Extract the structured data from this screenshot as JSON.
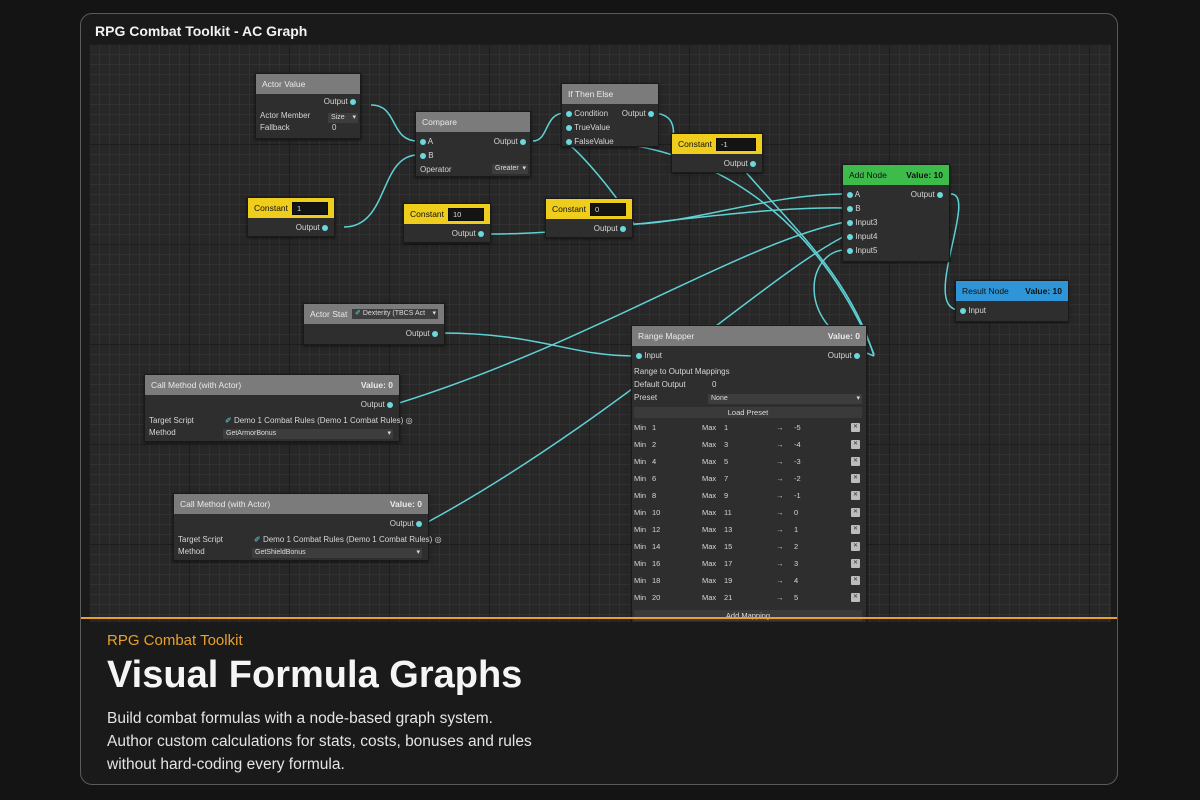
{
  "window": {
    "title": "RPG Combat Toolkit - AC Graph"
  },
  "nodes": {
    "actor_value": {
      "title": "Actor Value",
      "output": "Output",
      "member_label": "Actor Member",
      "member_value": "Size",
      "fallback_label": "Fallback",
      "fallback_value": "0"
    },
    "compare": {
      "title": "Compare",
      "in_a": "A",
      "in_b": "B",
      "output": "Output",
      "operator_label": "Operator",
      "operator_value": "Greater"
    },
    "if_then_else": {
      "title": "If Then Else",
      "condition": "Condition",
      "true_value": "TrueValue",
      "false_value": "FalseValue",
      "output": "Output"
    },
    "constant_neg1": {
      "title": "Constant",
      "value": "-1",
      "output": "Output"
    },
    "constant_1": {
      "title": "Constant",
      "value": "1",
      "output": "Output"
    },
    "constant_10": {
      "title": "Constant",
      "value": "10",
      "output": "Output"
    },
    "constant_0": {
      "title": "Constant",
      "value": "0",
      "output": "Output"
    },
    "add_node": {
      "title": "Add Node",
      "value": "Value: 10",
      "inputs": [
        "A",
        "B",
        "Input3",
        "Input4",
        "Input5"
      ],
      "output": "Output"
    },
    "result_node": {
      "title": "Result Node",
      "value": "Value: 10",
      "input": "Input"
    },
    "actor_stat": {
      "title": "Actor Stat",
      "stat_value": "Dexterity (TBCS Act",
      "output": "Output"
    },
    "call_method_1": {
      "title": "Call Method (with Actor)",
      "value": "Value: 0",
      "output": "Output",
      "script_label": "Target Script",
      "script_value": "Demo 1 Combat Rules (Demo 1 Combat Rules)",
      "method_label": "Method",
      "method_value": "GetArmorBonus"
    },
    "call_method_2": {
      "title": "Call Method (with Actor)",
      "value": "Value: 0",
      "output": "Output",
      "script_label": "Target Script",
      "script_value": "Demo 1 Combat Rules (Demo 1 Combat Rules)",
      "method_label": "Method",
      "method_value": "GetShieldBonus"
    },
    "range_mapper": {
      "title": "Range Mapper",
      "value": "Value: 0",
      "input": "Input",
      "output": "Output",
      "mappings_label": "Range to Output Mappings",
      "default_label": "Default Output",
      "default_value": "0",
      "preset_label": "Preset",
      "preset_value": "None",
      "load_preset": "Load Preset",
      "add_mapping": "Add Mapping",
      "min_label": "Min",
      "max_label": "Max",
      "arrow": "→",
      "rows": [
        {
          "min": "1",
          "max": "1",
          "out": "-5"
        },
        {
          "min": "2",
          "max": "3",
          "out": "-4"
        },
        {
          "min": "4",
          "max": "5",
          "out": "-3"
        },
        {
          "min": "6",
          "max": "7",
          "out": "-2"
        },
        {
          "min": "8",
          "max": "9",
          "out": "-1"
        },
        {
          "min": "10",
          "max": "11",
          "out": "0"
        },
        {
          "min": "12",
          "max": "13",
          "out": "1"
        },
        {
          "min": "14",
          "max": "15",
          "out": "2"
        },
        {
          "min": "16",
          "max": "17",
          "out": "3"
        },
        {
          "min": "18",
          "max": "19",
          "out": "4"
        },
        {
          "min": "20",
          "max": "21",
          "out": "5"
        }
      ]
    }
  },
  "caption": {
    "subtitle": "RPG Combat Toolkit",
    "headline": "Visual Formula Graphs",
    "lines": [
      "Build combat formulas with a node-based graph system.",
      "Author custom calculations for stats, costs, bonuses and rules",
      "without hard-coding every formula."
    ]
  },
  "colors": {
    "accent": "#e9a12b",
    "constant": "#efcd1c",
    "add": "#3dbb4b",
    "result": "#2f95d6",
    "wire": "#5fd2d6"
  }
}
